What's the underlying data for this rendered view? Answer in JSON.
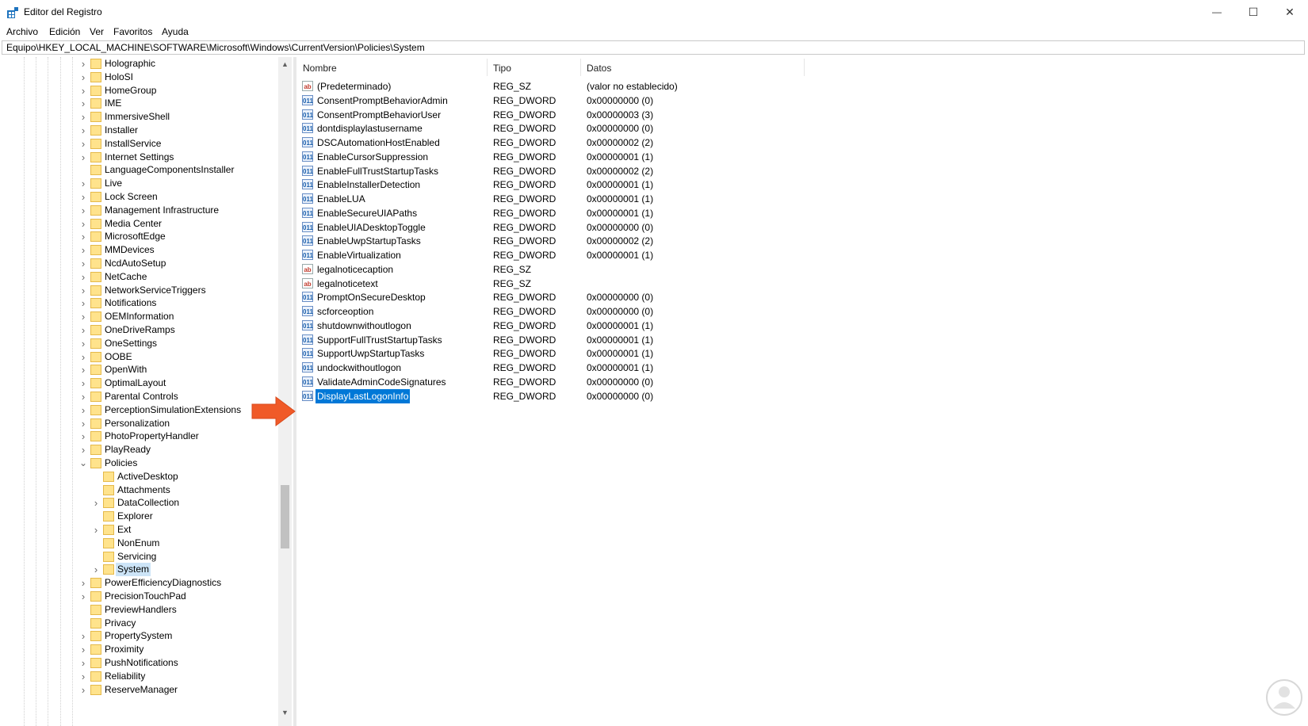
{
  "window": {
    "title": "Editor del Registro",
    "buttons": {
      "minimize": "—",
      "maximize": "☐",
      "close": "✕"
    }
  },
  "menu": [
    "Archivo",
    "Edición",
    "Ver",
    "Favoritos",
    "Ayuda"
  ],
  "address": "Equipo\\HKEY_LOCAL_MACHINE\\SOFTWARE\\Microsoft\\Windows\\CurrentVersion\\Policies\\System",
  "tree": [
    {
      "label": "Holographic",
      "level": 0,
      "expander": "collapsed"
    },
    {
      "label": "HoloSI",
      "level": 0,
      "expander": "collapsed"
    },
    {
      "label": "HomeGroup",
      "level": 0,
      "expander": "collapsed"
    },
    {
      "label": "IME",
      "level": 0,
      "expander": "collapsed"
    },
    {
      "label": "ImmersiveShell",
      "level": 0,
      "expander": "collapsed"
    },
    {
      "label": "Installer",
      "level": 0,
      "expander": "collapsed"
    },
    {
      "label": "InstallService",
      "level": 0,
      "expander": "collapsed"
    },
    {
      "label": "Internet Settings",
      "level": 0,
      "expander": "collapsed"
    },
    {
      "label": "LanguageComponentsInstaller",
      "level": 0,
      "expander": "none"
    },
    {
      "label": "Live",
      "level": 0,
      "expander": "collapsed"
    },
    {
      "label": "Lock Screen",
      "level": 0,
      "expander": "collapsed"
    },
    {
      "label": "Management Infrastructure",
      "level": 0,
      "expander": "collapsed"
    },
    {
      "label": "Media Center",
      "level": 0,
      "expander": "collapsed"
    },
    {
      "label": "MicrosoftEdge",
      "level": 0,
      "expander": "collapsed"
    },
    {
      "label": "MMDevices",
      "level": 0,
      "expander": "collapsed"
    },
    {
      "label": "NcdAutoSetup",
      "level": 0,
      "expander": "collapsed"
    },
    {
      "label": "NetCache",
      "level": 0,
      "expander": "collapsed"
    },
    {
      "label": "NetworkServiceTriggers",
      "level": 0,
      "expander": "collapsed"
    },
    {
      "label": "Notifications",
      "level": 0,
      "expander": "collapsed"
    },
    {
      "label": "OEMInformation",
      "level": 0,
      "expander": "collapsed"
    },
    {
      "label": "OneDriveRamps",
      "level": 0,
      "expander": "collapsed"
    },
    {
      "label": "OneSettings",
      "level": 0,
      "expander": "collapsed"
    },
    {
      "label": "OOBE",
      "level": 0,
      "expander": "collapsed"
    },
    {
      "label": "OpenWith",
      "level": 0,
      "expander": "collapsed"
    },
    {
      "label": "OptimalLayout",
      "level": 0,
      "expander": "collapsed"
    },
    {
      "label": "Parental Controls",
      "level": 0,
      "expander": "collapsed"
    },
    {
      "label": "PerceptionSimulationExtensions",
      "level": 0,
      "expander": "collapsed"
    },
    {
      "label": "Personalization",
      "level": 0,
      "expander": "collapsed"
    },
    {
      "label": "PhotoPropertyHandler",
      "level": 0,
      "expander": "collapsed"
    },
    {
      "label": "PlayReady",
      "level": 0,
      "expander": "collapsed"
    },
    {
      "label": "Policies",
      "level": 0,
      "expander": "expanded"
    },
    {
      "label": "ActiveDesktop",
      "level": 1,
      "expander": "none"
    },
    {
      "label": "Attachments",
      "level": 1,
      "expander": "none"
    },
    {
      "label": "DataCollection",
      "level": 1,
      "expander": "collapsed"
    },
    {
      "label": "Explorer",
      "level": 1,
      "expander": "none"
    },
    {
      "label": "Ext",
      "level": 1,
      "expander": "collapsed"
    },
    {
      "label": "NonEnum",
      "level": 1,
      "expander": "none"
    },
    {
      "label": "Servicing",
      "level": 1,
      "expander": "none"
    },
    {
      "label": "System",
      "level": 1,
      "expander": "collapsed",
      "selected": true
    },
    {
      "label": "PowerEfficiencyDiagnostics",
      "level": 0,
      "expander": "collapsed"
    },
    {
      "label": "PrecisionTouchPad",
      "level": 0,
      "expander": "collapsed"
    },
    {
      "label": "PreviewHandlers",
      "level": 0,
      "expander": "none"
    },
    {
      "label": "Privacy",
      "level": 0,
      "expander": "none"
    },
    {
      "label": "PropertySystem",
      "level": 0,
      "expander": "collapsed"
    },
    {
      "label": "Proximity",
      "level": 0,
      "expander": "collapsed"
    },
    {
      "label": "PushNotifications",
      "level": 0,
      "expander": "collapsed"
    },
    {
      "label": "Reliability",
      "level": 0,
      "expander": "collapsed"
    },
    {
      "label": "ReserveManager",
      "level": 0,
      "expander": "collapsed"
    }
  ],
  "columns": {
    "name": "Nombre",
    "type": "Tipo",
    "data": "Datos"
  },
  "values": [
    {
      "name": "(Predeterminado)",
      "type": "REG_SZ",
      "data": "(valor no establecido)",
      "icon": "string-value-icon"
    },
    {
      "name": "ConsentPromptBehaviorAdmin",
      "type": "REG_DWORD",
      "data": "0x00000000 (0)",
      "icon": "dword-value-icon"
    },
    {
      "name": "ConsentPromptBehaviorUser",
      "type": "REG_DWORD",
      "data": "0x00000003 (3)",
      "icon": "dword-value-icon"
    },
    {
      "name": "dontdisplaylastusername",
      "type": "REG_DWORD",
      "data": "0x00000000 (0)",
      "icon": "dword-value-icon"
    },
    {
      "name": "DSCAutomationHostEnabled",
      "type": "REG_DWORD",
      "data": "0x00000002 (2)",
      "icon": "dword-value-icon"
    },
    {
      "name": "EnableCursorSuppression",
      "type": "REG_DWORD",
      "data": "0x00000001 (1)",
      "icon": "dword-value-icon"
    },
    {
      "name": "EnableFullTrustStartupTasks",
      "type": "REG_DWORD",
      "data": "0x00000002 (2)",
      "icon": "dword-value-icon"
    },
    {
      "name": "EnableInstallerDetection",
      "type": "REG_DWORD",
      "data": "0x00000001 (1)",
      "icon": "dword-value-icon"
    },
    {
      "name": "EnableLUA",
      "type": "REG_DWORD",
      "data": "0x00000001 (1)",
      "icon": "dword-value-icon"
    },
    {
      "name": "EnableSecureUIAPaths",
      "type": "REG_DWORD",
      "data": "0x00000001 (1)",
      "icon": "dword-value-icon"
    },
    {
      "name": "EnableUIADesktopToggle",
      "type": "REG_DWORD",
      "data": "0x00000000 (0)",
      "icon": "dword-value-icon"
    },
    {
      "name": "EnableUwpStartupTasks",
      "type": "REG_DWORD",
      "data": "0x00000002 (2)",
      "icon": "dword-value-icon"
    },
    {
      "name": "EnableVirtualization",
      "type": "REG_DWORD",
      "data": "0x00000001 (1)",
      "icon": "dword-value-icon"
    },
    {
      "name": "legalnoticecaption",
      "type": "REG_SZ",
      "data": "",
      "icon": "string-value-icon"
    },
    {
      "name": "legalnoticetext",
      "type": "REG_SZ",
      "data": "",
      "icon": "string-value-icon"
    },
    {
      "name": "PromptOnSecureDesktop",
      "type": "REG_DWORD",
      "data": "0x00000000 (0)",
      "icon": "dword-value-icon"
    },
    {
      "name": "scforceoption",
      "type": "REG_DWORD",
      "data": "0x00000000 (0)",
      "icon": "dword-value-icon"
    },
    {
      "name": "shutdownwithoutlogon",
      "type": "REG_DWORD",
      "data": "0x00000001 (1)",
      "icon": "dword-value-icon"
    },
    {
      "name": "SupportFullTrustStartupTasks",
      "type": "REG_DWORD",
      "data": "0x00000001 (1)",
      "icon": "dword-value-icon"
    },
    {
      "name": "SupportUwpStartupTasks",
      "type": "REG_DWORD",
      "data": "0x00000001 (1)",
      "icon": "dword-value-icon"
    },
    {
      "name": "undockwithoutlogon",
      "type": "REG_DWORD",
      "data": "0x00000001 (1)",
      "icon": "dword-value-icon"
    },
    {
      "name": "ValidateAdminCodeSignatures",
      "type": "REG_DWORD",
      "data": "0x00000000 (0)",
      "icon": "dword-value-icon"
    },
    {
      "name": "DisplayLastLogonInfo",
      "type": "REG_DWORD",
      "data": "0x00000000 (0)",
      "icon": "dword-value-icon",
      "selected": true
    }
  ],
  "colors": {
    "selection": "#0078d7",
    "tree_selection": "#cce4f7",
    "arrow": "#f05a28",
    "folder": "#ffe38c"
  }
}
